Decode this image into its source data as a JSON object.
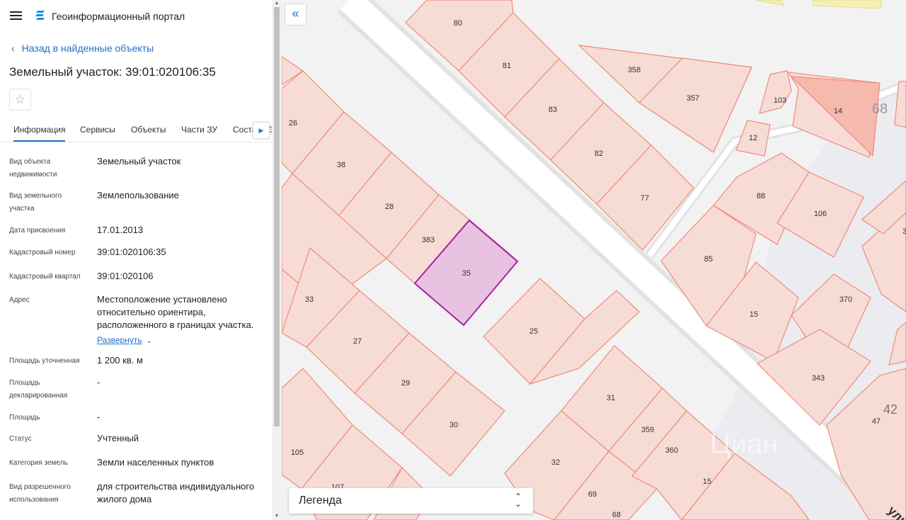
{
  "header": {
    "app_title": "Геоинформационный портал",
    "menu_icon": "hamburger-icon",
    "logo_icon": "portal-logo-icon"
  },
  "back_link": "Назад в найденные объекты",
  "object_title": "Земельный участок: 39:01:020106:35",
  "favorite_icon": "star-icon",
  "tabs": [
    {
      "label": "Информация",
      "active": true
    },
    {
      "label": "Сервисы"
    },
    {
      "label": "Объекты"
    },
    {
      "label": "Части ЗУ"
    },
    {
      "label": "Состав ЕЗП"
    }
  ],
  "info_rows": [
    {
      "label": "Вид объекта недвижимости",
      "value": "Земельный участок"
    },
    {
      "label": "Вид земельного участка",
      "value": "Землепользование"
    },
    {
      "label": "Дата присвоения",
      "value": "17.01.2013"
    },
    {
      "label": "Кадастровый номер",
      "value": "39:01:020106:35"
    },
    {
      "label": "Кадастровый квартал",
      "value": "39:01:020106"
    },
    {
      "label": "Адрес",
      "value": "Местоположение установлено относительно ориентира, расположенного в границах участка.",
      "expand_label": "Развернуть"
    },
    {
      "label": "Площадь уточненная",
      "value": "1 200 кв. м"
    },
    {
      "label": "Площадь декларированная",
      "value": "-"
    },
    {
      "label": "Площадь",
      "value": "-"
    },
    {
      "label": "Статус",
      "value": "Учтенный"
    },
    {
      "label": "Категория земель",
      "value": "Земли населенных пунктов"
    },
    {
      "label": "Вид разрешенного использования",
      "value": "для строительства индивидуального жилого дома"
    }
  ],
  "map": {
    "collapse_icon": "double-chevron-left-icon",
    "legend_label": "Легенда",
    "selected_parcel": "35",
    "parcel_labels": [
      "80",
      "81",
      "83",
      "82",
      "77",
      "358",
      "357",
      "103",
      "14",
      "68",
      "12",
      "88",
      "106",
      "26",
      "38",
      "28",
      "383",
      "35",
      "33",
      "27",
      "29",
      "30",
      "25",
      "31",
      "359",
      "360",
      "32",
      "69",
      "68",
      "15",
      "85",
      "15",
      "370",
      "343",
      "42",
      "47",
      "105",
      "107",
      "3"
    ],
    "road_label": "ули",
    "watermark": "Циан",
    "colors": {
      "parcel_stroke": "#f08a7a",
      "parcel_fill": "#f7dcd6",
      "selected_stroke": "#a324a8",
      "selected_fill": "#e9c1e1",
      "accent": "#1f6fc5"
    }
  }
}
